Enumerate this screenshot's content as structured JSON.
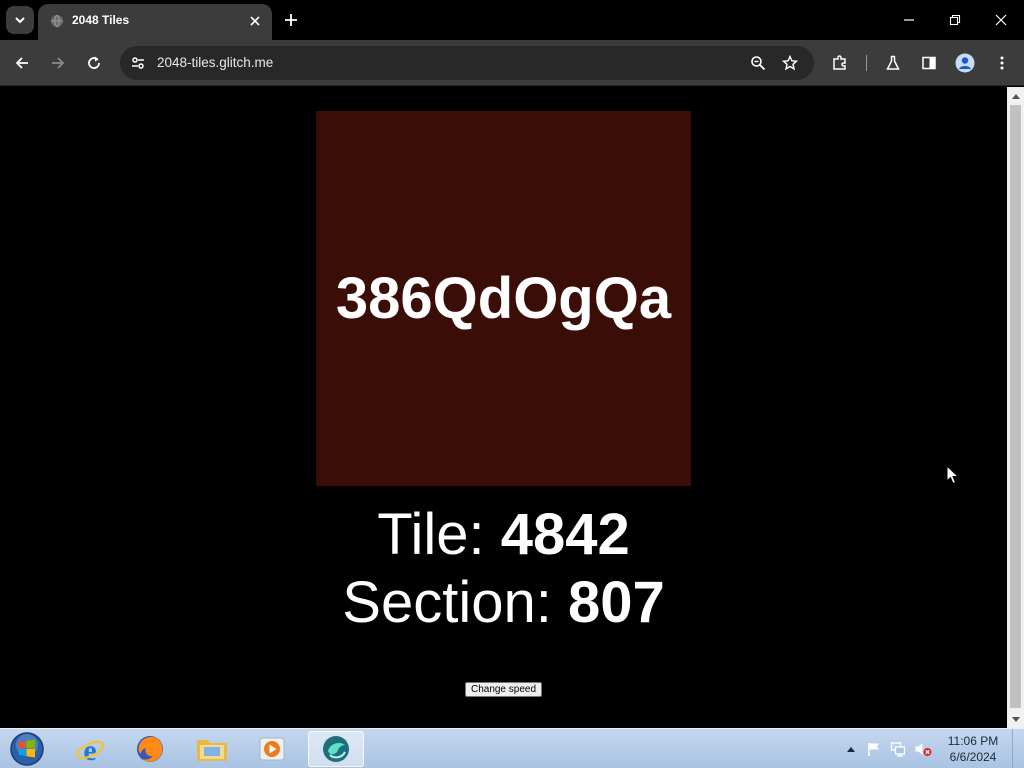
{
  "browser": {
    "tab": {
      "title": "2048 Tiles"
    },
    "address_bar": {
      "url": "2048-tiles.glitch.me"
    }
  },
  "page": {
    "tile_code": "386QdOgQa",
    "tile_color": "#3a0d06",
    "tile_label": "Tile: ",
    "tile_number": "4842",
    "section_label": "Section: ",
    "section_number": "807",
    "change_speed_button": "Change speed"
  },
  "taskbar": {
    "apps": [
      "start-orb",
      "internet-explorer-icon",
      "firefox-icon",
      "file-explorer-icon",
      "media-player-icon",
      "app-icon"
    ],
    "clock": {
      "time": "11:06 PM",
      "date": "6/6/2024"
    }
  }
}
